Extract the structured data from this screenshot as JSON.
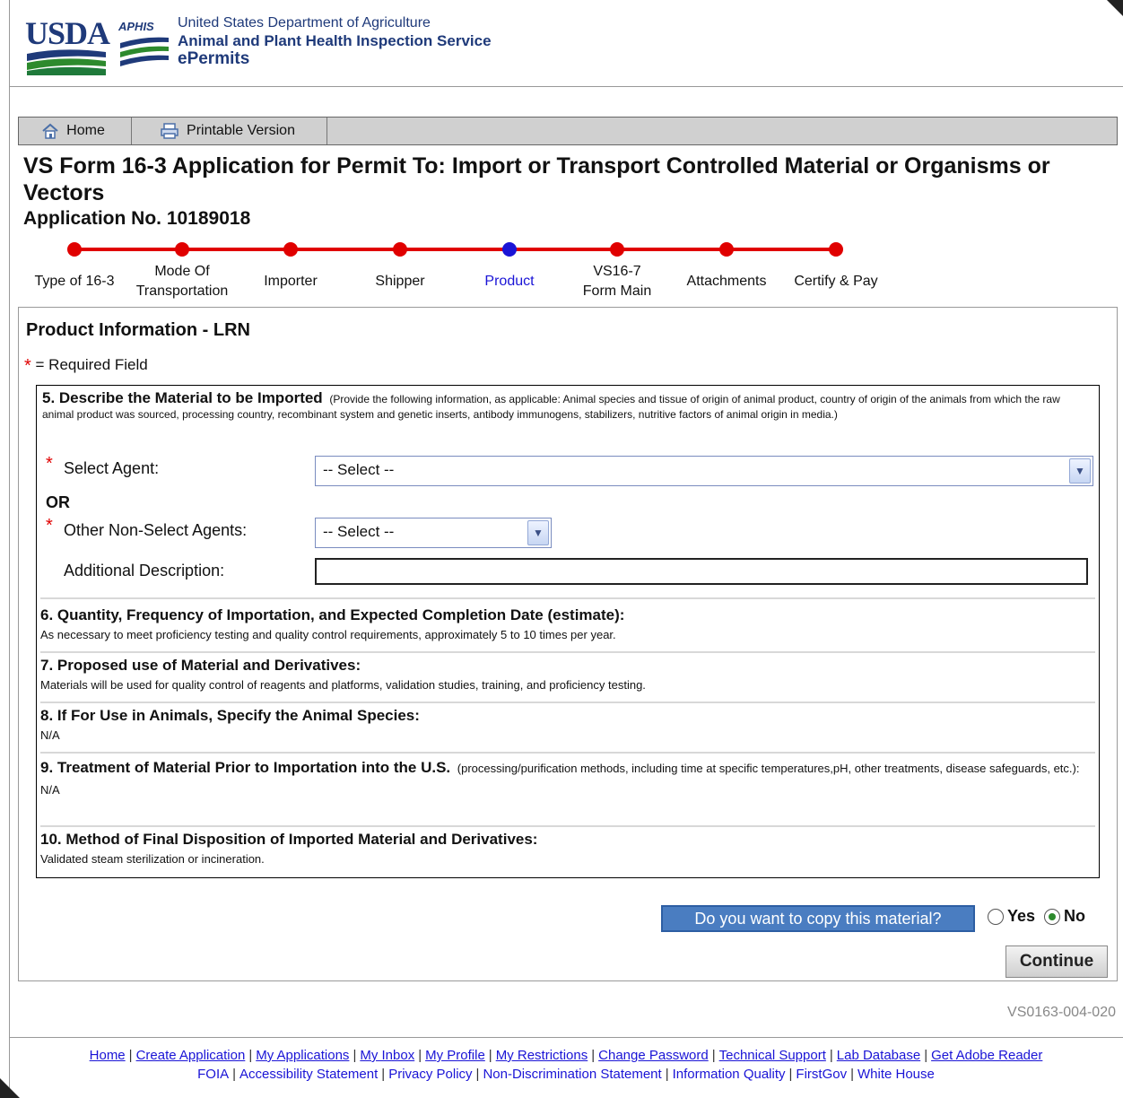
{
  "header": {
    "usda": "USDA",
    "aphis": "APHIS",
    "dept": "United States Department of Agriculture",
    "agency": "Animal and Plant Health Inspection Service",
    "app": "ePermits"
  },
  "toolbar": {
    "home_label": "Home",
    "print_label": "Printable Version"
  },
  "form": {
    "title": "VS Form 16-3 Application for Permit To: Import or Transport Controlled Material or Organisms or Vectors",
    "application_no": "Application No. 10189018"
  },
  "progress": {
    "steps": [
      {
        "label": "Type of 16-3",
        "active": false
      },
      {
        "label": "Mode Of Transportation",
        "active": false
      },
      {
        "label": "Importer",
        "active": false
      },
      {
        "label": "Shipper",
        "active": false
      },
      {
        "label": "Product",
        "active": true
      },
      {
        "label": "VS16-7 Form Main",
        "active": false
      },
      {
        "label": "Attachments",
        "active": false
      },
      {
        "label": "Certify & Pay",
        "active": false
      }
    ]
  },
  "panel": {
    "title": "Product Information - LRN",
    "required_legend": "= Required Field"
  },
  "section5": {
    "heading": "5. Describe the Material to be Imported",
    "note": "(Provide the following information, as applicable: Animal species and tissue of origin of animal product, country of origin of the animals from which the raw animal product was sourced, processing country, recombinant system and genetic inserts, antibody immunogens, stabilizers, nutritive factors of animal origin in media.)",
    "select_agent_label": "Select Agent:",
    "select_agent_value": "-- Select --",
    "or_label": "OR",
    "other_agents_label": "Other Non-Select Agents:",
    "other_agents_value": "-- Select --",
    "additional_label": "Additional Description:",
    "additional_value": ""
  },
  "section6": {
    "heading": "6. Quantity, Frequency of Importation, and Expected Completion Date (estimate):",
    "body": "As necessary to meet proficiency testing and quality control requirements, approximately 5 to 10 times per year."
  },
  "section7": {
    "heading": "7. Proposed use of Material and Derivatives:",
    "body": "Materials will be used for quality control of reagents and platforms, validation studies, training, and proficiency testing."
  },
  "section8": {
    "heading": "8. If For Use in Animals, Specify the Animal Species:",
    "body": "N/A"
  },
  "section9": {
    "heading": "9. Treatment of Material Prior to Importation into the U.S.",
    "note": "(processing/purification methods, including time at specific temperatures,pH, other treatments, disease safeguards, etc.):",
    "body": "N/A"
  },
  "section10": {
    "heading": "10. Method of Final Disposition of Imported Material and Derivatives:",
    "body": "Validated steam sterilization or incineration."
  },
  "copy": {
    "question": "Do you want to copy this material?",
    "yes_label": "Yes",
    "no_label": "No",
    "selected": "No"
  },
  "continue_label": "Continue",
  "page_code": "VS0163-004-020",
  "footer": {
    "links_row1": [
      "Home",
      "Create Application",
      "My Applications",
      "My Inbox",
      "My Profile",
      "My Restrictions",
      "Change Password",
      "Technical Support",
      "Lab Database",
      "Get Adobe Reader"
    ],
    "links_row2": [
      "FOIA",
      "Accessibility Statement",
      "Privacy Policy",
      "Non-Discrimination Statement",
      "Information Quality",
      "FirstGov",
      "White House"
    ]
  }
}
